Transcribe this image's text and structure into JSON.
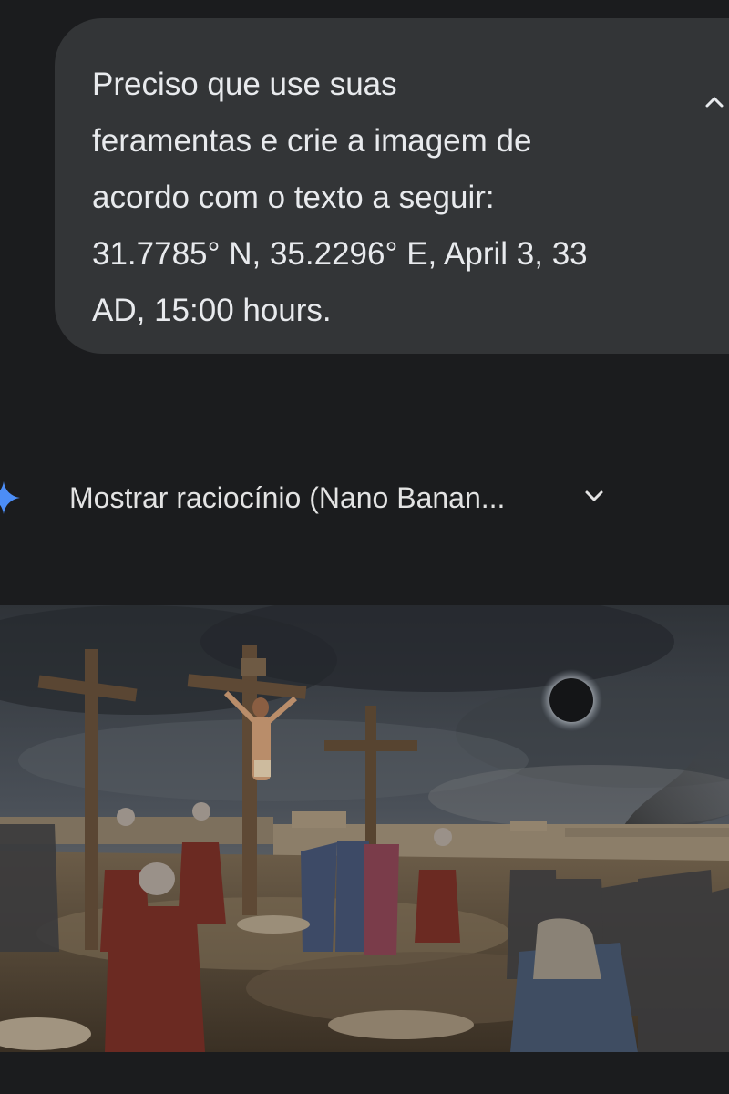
{
  "user_message": {
    "text": "Preciso que use suas\nferamentas e crie a imagem de\nacordo com o texto a seguir:\n31.7785° N, 35.2296° E, April 3, 33\nAD, 15:00 hours.",
    "collapse_icon": "chevron-up-icon"
  },
  "reasoning": {
    "label": "Mostrar raciocínio (Nano Banan...",
    "leading_icon": "gemini-spark-icon",
    "toggle_icon": "chevron-down-icon"
  },
  "generated_image": {
    "description_icon": "image-crucifixion-scene"
  },
  "colors": {
    "background": "#1b1c1e",
    "bubble": "#333537",
    "text": "#e8eaed",
    "spark_blue": "#4c8df6"
  }
}
